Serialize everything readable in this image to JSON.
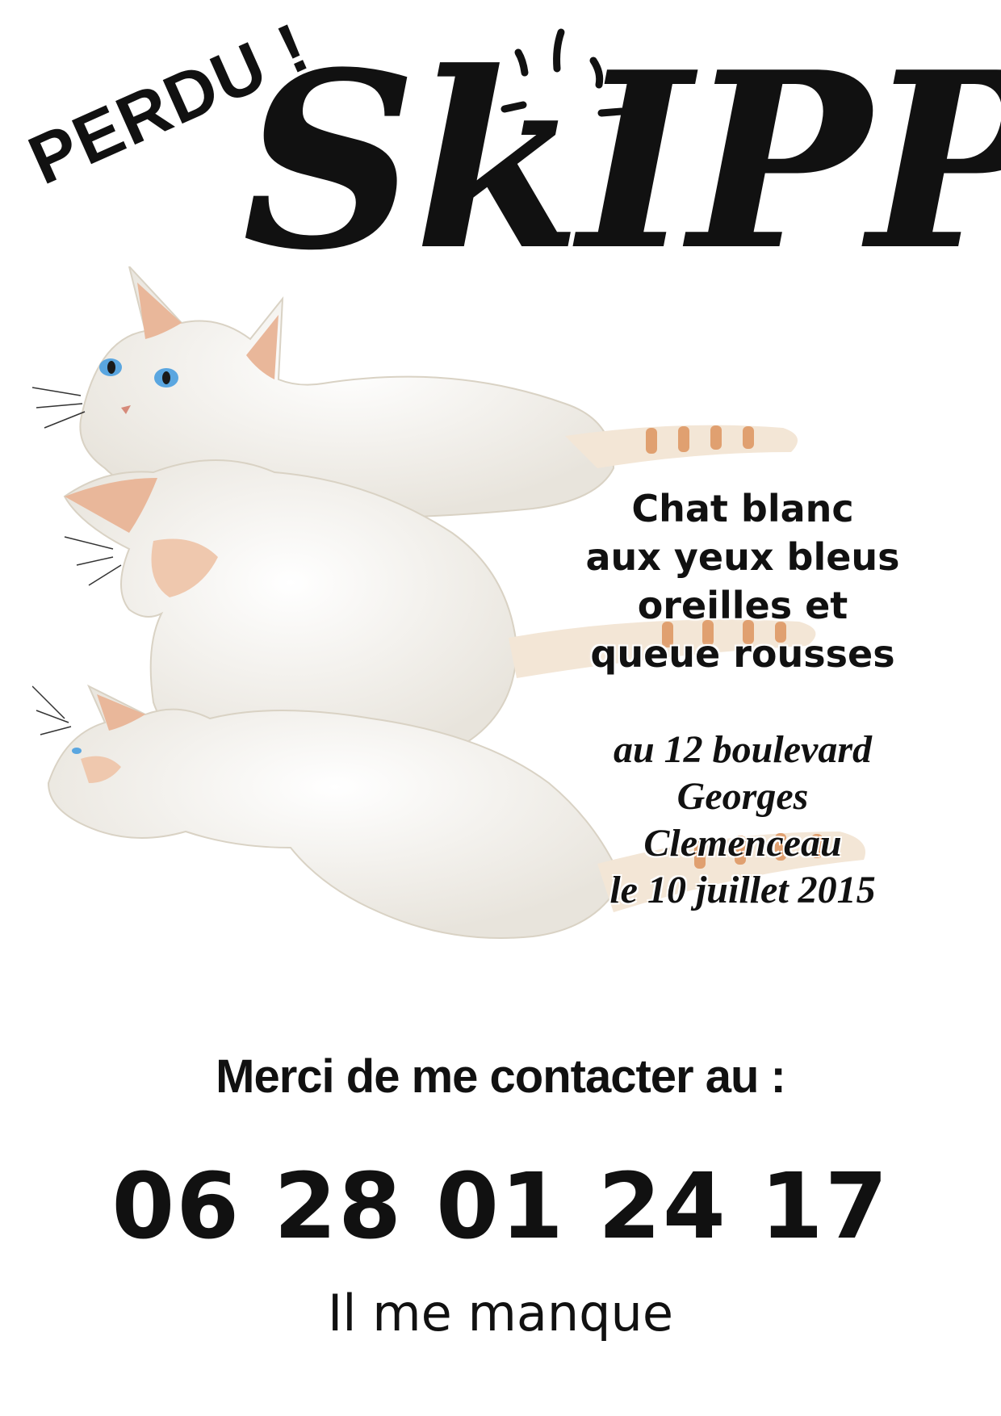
{
  "header": {
    "perdu": "PERDU !",
    "name": "SkIPPY"
  },
  "description": {
    "lines": [
      "Chat blanc",
      "aux yeux bleus",
      "oreilles et",
      "queue rousses"
    ]
  },
  "location": {
    "lines": [
      "au 12 boulevard",
      "Georges",
      "Clemenceau",
      "le 10 juillet 2015"
    ]
  },
  "contact": {
    "label": "Merci de me contacter au :",
    "phone": "06 28 01 24 17",
    "closing": "Il me manque"
  },
  "colors": {
    "text": "#111111",
    "fur": "#f4f1ea",
    "ginger": "#e0a070",
    "eyes": "#5aa6e0"
  }
}
